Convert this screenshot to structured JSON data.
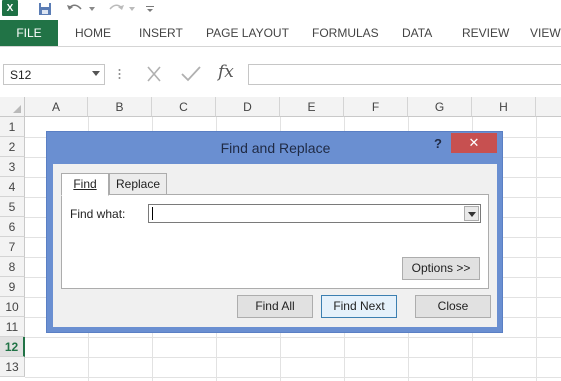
{
  "qat": {
    "app_logo": "X",
    "icons": [
      "excel-logo",
      "save-icon",
      "undo-icon",
      "redo-icon",
      "customize-icon"
    ]
  },
  "ribbon": {
    "tabs": [
      "FILE",
      "HOME",
      "INSERT",
      "PAGE LAYOUT",
      "FORMULAS",
      "DATA",
      "REVIEW",
      "VIEW"
    ],
    "accent": "#217346"
  },
  "formula_bar": {
    "namebox_value": "S12",
    "fx_label": "fx",
    "value": ""
  },
  "grid": {
    "columns": [
      "A",
      "B",
      "C",
      "D",
      "E",
      "F",
      "G",
      "H"
    ],
    "rows": [
      "1",
      "2",
      "3",
      "4",
      "5",
      "6",
      "7",
      "8",
      "9",
      "10",
      "11",
      "12",
      "13"
    ],
    "active_row": "12"
  },
  "dialog": {
    "title": "Find and Replace",
    "help": "?",
    "close": "✕",
    "tabs": [
      "Find",
      "Replace"
    ],
    "active_tab": "Find",
    "find_what_label": "Find what:",
    "find_what_value": "",
    "options_label": "Options >>",
    "find_all_label": "Find All",
    "find_next_label": "Find Next",
    "close_label": "Close",
    "title_color": "#6a8fd1",
    "close_color": "#c75050"
  }
}
